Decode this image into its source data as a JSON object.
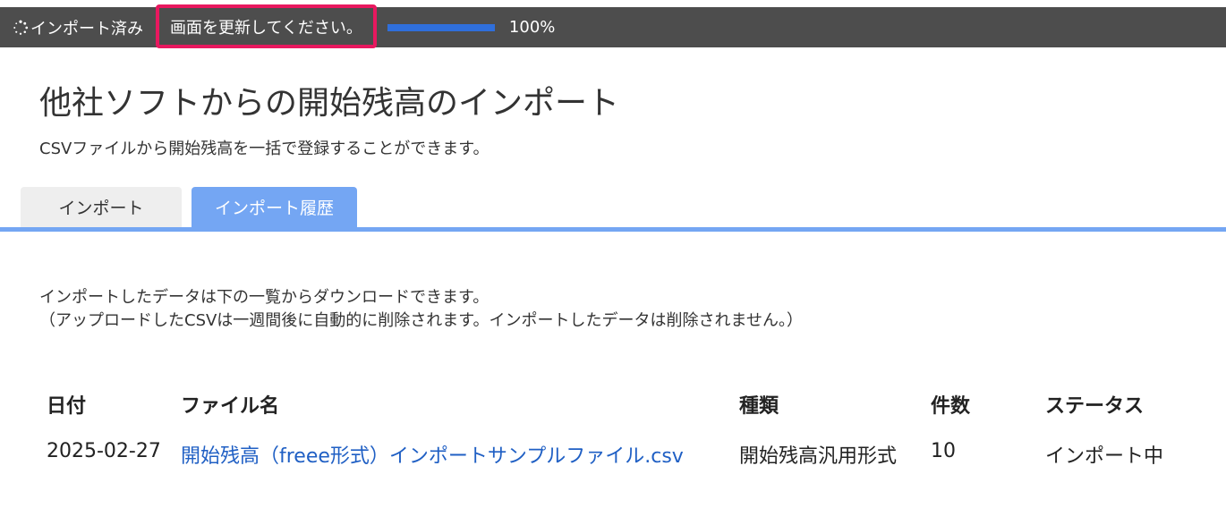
{
  "topbar": {
    "status_label": "インポート済み",
    "refresh_message": "画面を更新してください。",
    "progress_value": 100,
    "progress_text": "100%",
    "accent": "#e8185f",
    "progress_color": "#2f6fdb"
  },
  "page": {
    "title": "他社ソフトからの開始残高のインポート",
    "subtitle": "CSVファイルから開始残高を一括で登録することができます。"
  },
  "tabs": {
    "import": "インポート",
    "history": "インポート履歴",
    "active": "history",
    "active_color": "#74a6f3"
  },
  "description": {
    "line1": "インポートしたデータは下の一覧からダウンロードできます。",
    "line2": "（アップロードしたCSVは一週間後に自動的に削除されます。インポートしたデータは削除されません。）"
  },
  "table": {
    "headers": [
      "日付",
      "ファイル名",
      "種類",
      "件数",
      "ステータス"
    ],
    "rows": [
      [
        "2025-02-27",
        "開始残高（freee形式）インポートサンプルファイル.csv",
        "開始残高汎用形式",
        "10",
        "インポート中"
      ]
    ]
  },
  "icons": {
    "spinner": "spinner-icon"
  }
}
